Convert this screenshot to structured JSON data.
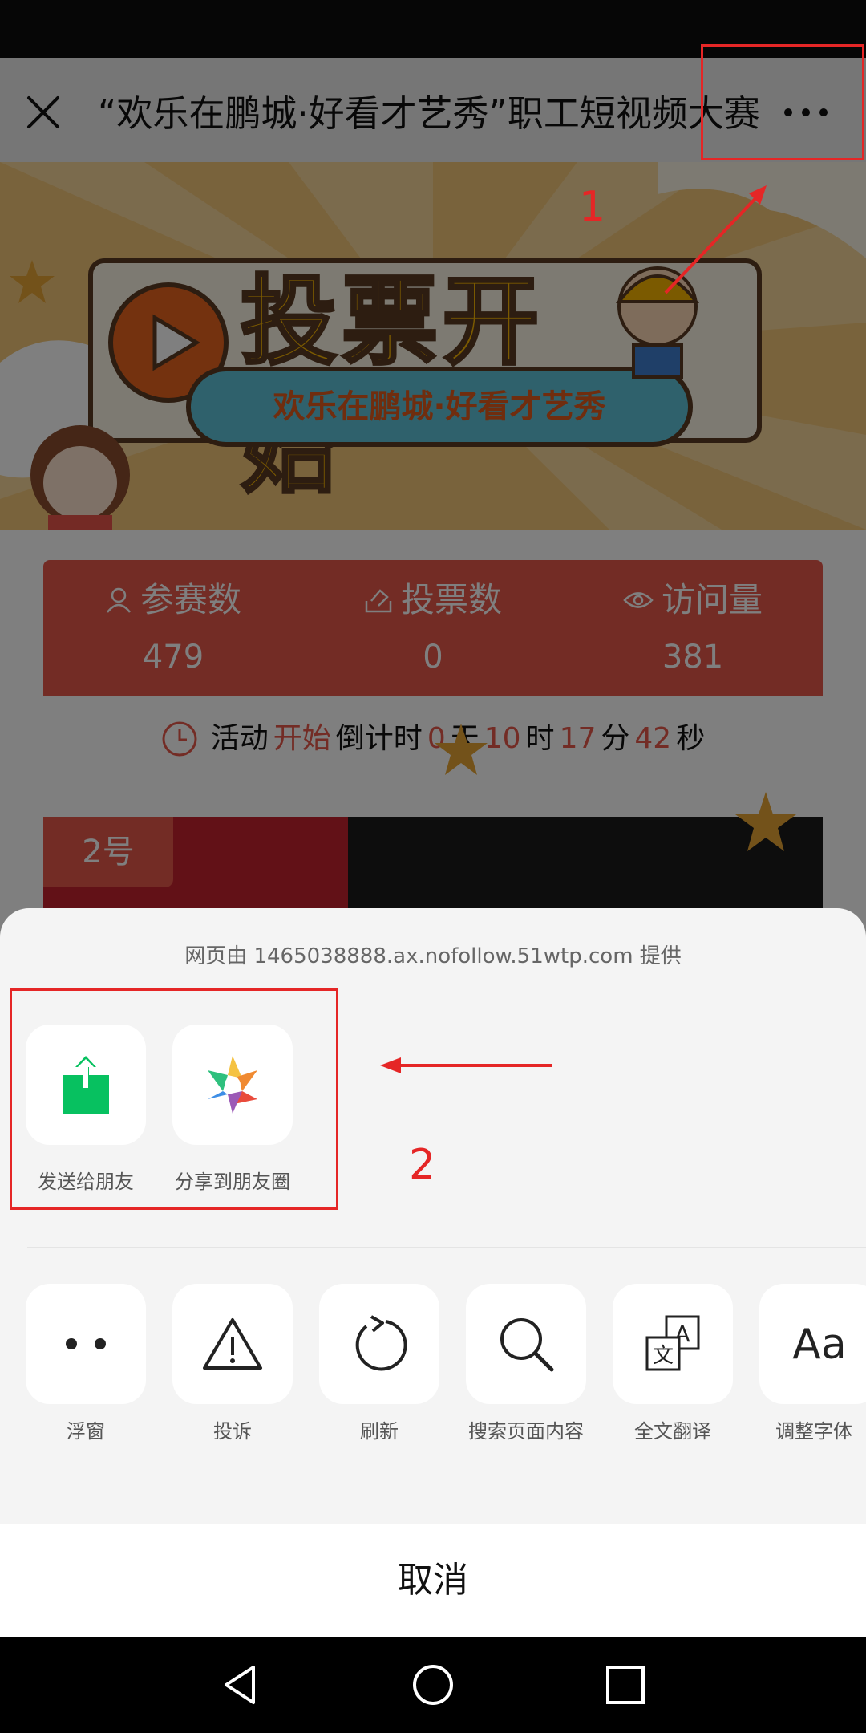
{
  "page": {
    "title": "“欢乐在鹏城·好看才艺秀”职工短视频大赛",
    "banner_headline": "投票开始",
    "banner_subtitle": "欢乐在鹏城·好看才艺秀"
  },
  "stats": [
    {
      "label": "参赛数",
      "value": "479",
      "icon": "person-icon"
    },
    {
      "label": "投票数",
      "value": "0",
      "icon": "vote-icon"
    },
    {
      "label": "访问量",
      "value": "381",
      "icon": "eye-icon"
    }
  ],
  "countdown": {
    "prefix": "活动",
    "highlight": "开始",
    "middle": "倒计时",
    "days": "0",
    "days_unit": "天",
    "hours": "10",
    "hours_unit": "时",
    "minutes": "17",
    "minutes_unit": "分",
    "seconds": "42",
    "seconds_unit": "秒"
  },
  "video": {
    "tag": "2号"
  },
  "sheet": {
    "provider": "网页由 1465038888.ax.nofollow.51wtp.com 提供",
    "share_row": [
      {
        "label": "发送给朋友",
        "icon": "send-to-friend-icon"
      },
      {
        "label": "分享到朋友圈",
        "icon": "moments-icon"
      }
    ],
    "action_row": [
      {
        "label": "浮窗",
        "icon": "float-window-icon"
      },
      {
        "label": "投诉",
        "icon": "warning-icon"
      },
      {
        "label": "刷新",
        "icon": "refresh-icon"
      },
      {
        "label": "搜索页面内容",
        "icon": "search-icon"
      },
      {
        "label": "全文翻译",
        "icon": "translate-icon"
      },
      {
        "label": "调整字体",
        "icon": "font-size-icon"
      }
    ],
    "cancel": "取消"
  },
  "annotations": {
    "step1": "1",
    "step2": "2"
  },
  "colors": {
    "accent_red": "#e7584a",
    "wechat_green": "#07c160",
    "annotation_red": "#e52626"
  }
}
